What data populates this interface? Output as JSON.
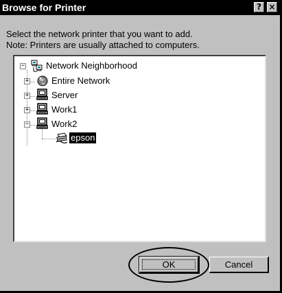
{
  "window": {
    "title": "Browse for Printer",
    "help_glyph": "?",
    "close_glyph": "×"
  },
  "instructions": {
    "line1": "Select the network printer that you want to add.",
    "line2": "Note: Printers are usually attached to computers."
  },
  "tree": {
    "root": {
      "label": "Network Neighborhood",
      "icon": "network-neighborhood-icon",
      "expander": "−"
    },
    "children": [
      {
        "label": "Entire Network",
        "icon": "globe-icon",
        "expander": "+"
      },
      {
        "label": "Server",
        "icon": "computer-icon",
        "expander": "+"
      },
      {
        "label": "Work1",
        "icon": "computer-icon",
        "expander": "+"
      },
      {
        "label": "Work2",
        "icon": "computer-icon",
        "expander": "−"
      }
    ],
    "printer": {
      "label": "epson",
      "icon": "network-printer-icon",
      "selected": true
    }
  },
  "buttons": {
    "ok": "OK",
    "cancel": "Cancel"
  }
}
